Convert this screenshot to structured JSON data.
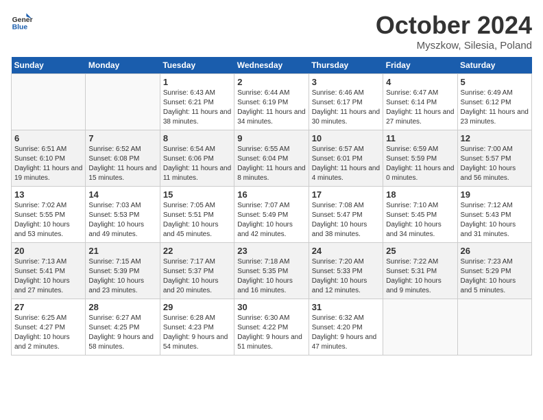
{
  "header": {
    "logo_line1": "General",
    "logo_line2": "Blue",
    "month": "October 2024",
    "location": "Myszkow, Silesia, Poland"
  },
  "weekdays": [
    "Sunday",
    "Monday",
    "Tuesday",
    "Wednesday",
    "Thursday",
    "Friday",
    "Saturday"
  ],
  "weeks": [
    [
      {
        "day": "",
        "info": ""
      },
      {
        "day": "",
        "info": ""
      },
      {
        "day": "1",
        "info": "Sunrise: 6:43 AM\nSunset: 6:21 PM\nDaylight: 11 hours and 38 minutes."
      },
      {
        "day": "2",
        "info": "Sunrise: 6:44 AM\nSunset: 6:19 PM\nDaylight: 11 hours and 34 minutes."
      },
      {
        "day": "3",
        "info": "Sunrise: 6:46 AM\nSunset: 6:17 PM\nDaylight: 11 hours and 30 minutes."
      },
      {
        "day": "4",
        "info": "Sunrise: 6:47 AM\nSunset: 6:14 PM\nDaylight: 11 hours and 27 minutes."
      },
      {
        "day": "5",
        "info": "Sunrise: 6:49 AM\nSunset: 6:12 PM\nDaylight: 11 hours and 23 minutes."
      }
    ],
    [
      {
        "day": "6",
        "info": "Sunrise: 6:51 AM\nSunset: 6:10 PM\nDaylight: 11 hours and 19 minutes."
      },
      {
        "day": "7",
        "info": "Sunrise: 6:52 AM\nSunset: 6:08 PM\nDaylight: 11 hours and 15 minutes."
      },
      {
        "day": "8",
        "info": "Sunrise: 6:54 AM\nSunset: 6:06 PM\nDaylight: 11 hours and 11 minutes."
      },
      {
        "day": "9",
        "info": "Sunrise: 6:55 AM\nSunset: 6:04 PM\nDaylight: 11 hours and 8 minutes."
      },
      {
        "day": "10",
        "info": "Sunrise: 6:57 AM\nSunset: 6:01 PM\nDaylight: 11 hours and 4 minutes."
      },
      {
        "day": "11",
        "info": "Sunrise: 6:59 AM\nSunset: 5:59 PM\nDaylight: 11 hours and 0 minutes."
      },
      {
        "day": "12",
        "info": "Sunrise: 7:00 AM\nSunset: 5:57 PM\nDaylight: 10 hours and 56 minutes."
      }
    ],
    [
      {
        "day": "13",
        "info": "Sunrise: 7:02 AM\nSunset: 5:55 PM\nDaylight: 10 hours and 53 minutes."
      },
      {
        "day": "14",
        "info": "Sunrise: 7:03 AM\nSunset: 5:53 PM\nDaylight: 10 hours and 49 minutes."
      },
      {
        "day": "15",
        "info": "Sunrise: 7:05 AM\nSunset: 5:51 PM\nDaylight: 10 hours and 45 minutes."
      },
      {
        "day": "16",
        "info": "Sunrise: 7:07 AM\nSunset: 5:49 PM\nDaylight: 10 hours and 42 minutes."
      },
      {
        "day": "17",
        "info": "Sunrise: 7:08 AM\nSunset: 5:47 PM\nDaylight: 10 hours and 38 minutes."
      },
      {
        "day": "18",
        "info": "Sunrise: 7:10 AM\nSunset: 5:45 PM\nDaylight: 10 hours and 34 minutes."
      },
      {
        "day": "19",
        "info": "Sunrise: 7:12 AM\nSunset: 5:43 PM\nDaylight: 10 hours and 31 minutes."
      }
    ],
    [
      {
        "day": "20",
        "info": "Sunrise: 7:13 AM\nSunset: 5:41 PM\nDaylight: 10 hours and 27 minutes."
      },
      {
        "day": "21",
        "info": "Sunrise: 7:15 AM\nSunset: 5:39 PM\nDaylight: 10 hours and 23 minutes."
      },
      {
        "day": "22",
        "info": "Sunrise: 7:17 AM\nSunset: 5:37 PM\nDaylight: 10 hours and 20 minutes."
      },
      {
        "day": "23",
        "info": "Sunrise: 7:18 AM\nSunset: 5:35 PM\nDaylight: 10 hours and 16 minutes."
      },
      {
        "day": "24",
        "info": "Sunrise: 7:20 AM\nSunset: 5:33 PM\nDaylight: 10 hours and 12 minutes."
      },
      {
        "day": "25",
        "info": "Sunrise: 7:22 AM\nSunset: 5:31 PM\nDaylight: 10 hours and 9 minutes."
      },
      {
        "day": "26",
        "info": "Sunrise: 7:23 AM\nSunset: 5:29 PM\nDaylight: 10 hours and 5 minutes."
      }
    ],
    [
      {
        "day": "27",
        "info": "Sunrise: 6:25 AM\nSunset: 4:27 PM\nDaylight: 10 hours and 2 minutes."
      },
      {
        "day": "28",
        "info": "Sunrise: 6:27 AM\nSunset: 4:25 PM\nDaylight: 9 hours and 58 minutes."
      },
      {
        "day": "29",
        "info": "Sunrise: 6:28 AM\nSunset: 4:23 PM\nDaylight: 9 hours and 54 minutes."
      },
      {
        "day": "30",
        "info": "Sunrise: 6:30 AM\nSunset: 4:22 PM\nDaylight: 9 hours and 51 minutes."
      },
      {
        "day": "31",
        "info": "Sunrise: 6:32 AM\nSunset: 4:20 PM\nDaylight: 9 hours and 47 minutes."
      },
      {
        "day": "",
        "info": ""
      },
      {
        "day": "",
        "info": ""
      }
    ]
  ]
}
